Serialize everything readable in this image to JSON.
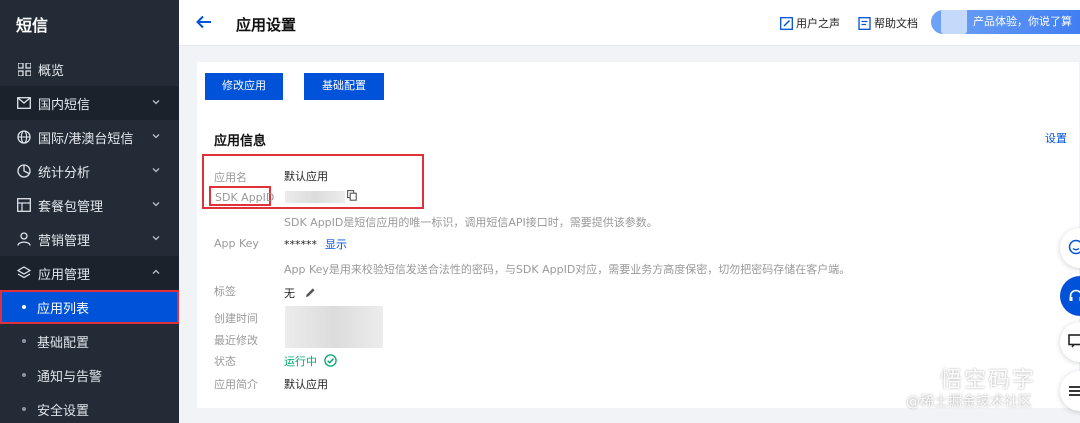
{
  "sidebar": {
    "title": "短信",
    "items": [
      {
        "label": "概览",
        "icon": "grid-icon"
      },
      {
        "label": "国内短信",
        "icon": "mail-icon"
      },
      {
        "label": "国际/港澳台短信",
        "icon": "globe-icon"
      },
      {
        "label": "统计分析",
        "icon": "chart-pie-icon"
      },
      {
        "label": "套餐包管理",
        "icon": "package-icon"
      },
      {
        "label": "营销管理",
        "icon": "user-icon"
      },
      {
        "label": "应用管理",
        "icon": "layers-icon"
      }
    ],
    "subitems": [
      {
        "label": "应用列表"
      },
      {
        "label": "基础配置"
      },
      {
        "label": "通知与告警"
      },
      {
        "label": "安全设置"
      }
    ]
  },
  "header": {
    "title": "应用设置",
    "user_voice": "用户之声",
    "help_docs": "帮助文档",
    "promo": "产品体验，你说了算"
  },
  "card": {
    "edit_button": "修改应用",
    "config_button": "基础配置",
    "section_title": "应用信息",
    "settings_link": "设置",
    "app_name_label": "应用名",
    "app_name_value": "默认应用",
    "appid_label": "SDK AppID",
    "appid_hint": "SDK AppID是短信应用的唯一标识，调用短信API接口时，需要提供该参数。",
    "appkey_label": "App Key",
    "appkey_value": "******",
    "appkey_show": "显示",
    "appkey_hint": "App Key是用来校验短信发送合法性的密码，与SDK AppID对应，需要业务方高度保密，切勿把密码存储在客户端。",
    "tag_label": "标签",
    "tag_value": "无",
    "created_label": "创建时间",
    "modified_label": "最近修改",
    "status_label": "状态",
    "status_value": "运行中",
    "desc_label": "应用简介",
    "desc_value": "默认应用"
  },
  "watermark": {
    "line1": "悟空码字",
    "line2": "@稀土掘金技术社区"
  },
  "colors": {
    "sidebar_bg": "#232b36",
    "primary": "#0052d9",
    "highlight": "#e0303a",
    "success": "#00a870"
  }
}
